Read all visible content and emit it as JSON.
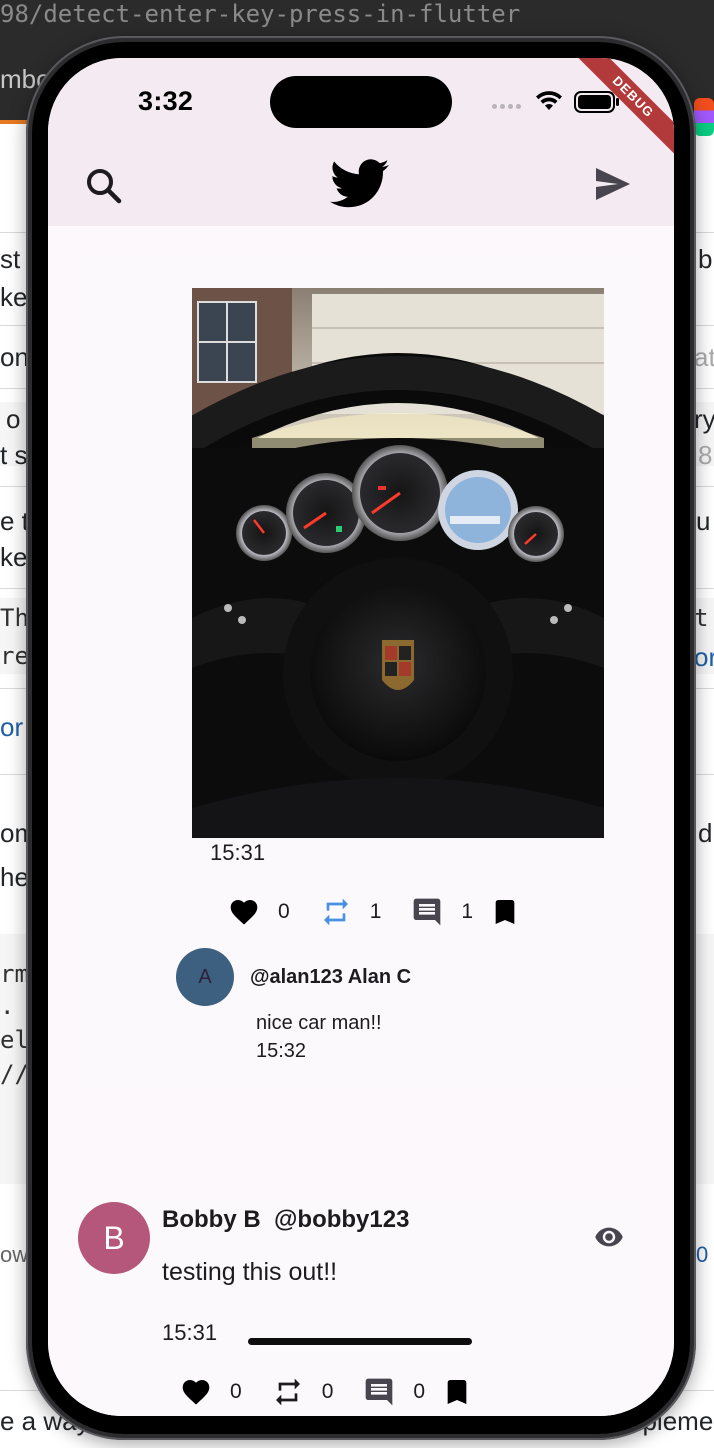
{
  "background": {
    "url_text": "98/detect-enter-key-press-in-flutter",
    "tab_text": "mbol",
    "left_fragments": [
      "st",
      "ke",
      "on",
      "o",
      "t s",
      "e t",
      "ke",
      "Th",
      "re",
      "or",
      "om",
      "he",
      "rm",
      ".",
      "el",
      "//",
      "ow",
      "e a way"
    ],
    "right_fragments": [
      "b",
      "at",
      "ry",
      "8",
      "u",
      "t",
      "or",
      "d",
      "0",
      "nplemen"
    ]
  },
  "status_bar": {
    "time": "3:32",
    "debug_label": "DEBUG"
  },
  "app_bar": {
    "left_icon": "search-icon",
    "center_icon": "twitter-bird-icon",
    "right_icon": "send-icon"
  },
  "tweets": [
    {
      "image_description_icon": "porsche-dashboard-photo",
      "time": "15:31",
      "likes": "0",
      "retweets": "1",
      "comments": "1",
      "retweet_color": "#4a90e2",
      "reply": {
        "avatar_letter": "A",
        "handle_name": "@alan123 Alan C",
        "text": "nice car man!!",
        "time": "15:32"
      }
    },
    {
      "avatar_letter": "B",
      "name": "Bobby B",
      "handle": "@bobby123",
      "text": "testing this out!!",
      "time": "15:31",
      "likes": "0",
      "retweets": "0",
      "comments": "0"
    }
  ],
  "colors": {
    "app_bar_bg": "#f4ebf2",
    "screen_bg": "#fdf8fc",
    "avatar_a": "#3e6080",
    "avatar_b": "#b5577a",
    "debug_banner": "#b23a3a"
  }
}
